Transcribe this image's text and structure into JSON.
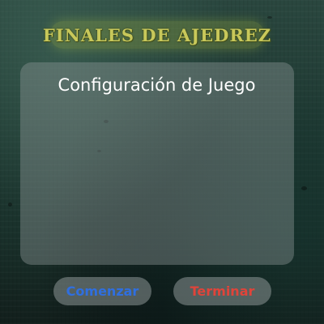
{
  "app": {
    "title": "FINALES DE AJEDREZ"
  },
  "panel": {
    "title": "Configuración de Juego"
  },
  "buttons": {
    "start_label": "Comenzar",
    "quit_label": "Terminar"
  },
  "colors": {
    "title_text": "#c8c85a",
    "start_button_text": "#2f6fe0",
    "quit_button_text": "#e0443a",
    "background": "#1f3a33"
  }
}
